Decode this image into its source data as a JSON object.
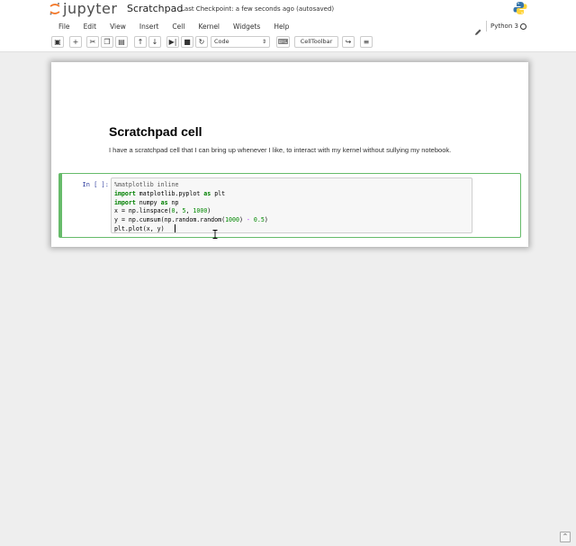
{
  "header": {
    "logo_text": "jupyter",
    "notebook_name": "Scratchpad",
    "checkpoint": "Last Checkpoint: a few seconds ago (autosaved)"
  },
  "menubar": {
    "items": [
      "File",
      "Edit",
      "View",
      "Insert",
      "Cell",
      "Kernel",
      "Widgets",
      "Help"
    ]
  },
  "kernel": {
    "name": "Python 3"
  },
  "toolbar": {
    "buttons": [
      {
        "name": "save-button",
        "glyph": "▣"
      },
      {
        "name": "insert-cell-below-button",
        "glyph": "+"
      },
      {
        "name": "cut-button",
        "glyph": "✂"
      },
      {
        "name": "copy-button",
        "glyph": "❐"
      },
      {
        "name": "paste-button",
        "glyph": "▤"
      },
      {
        "name": "move-up-button",
        "glyph": "↑"
      },
      {
        "name": "move-down-button",
        "glyph": "↓"
      },
      {
        "name": "run-button",
        "glyph": "▶|"
      },
      {
        "name": "interrupt-button",
        "glyph": "■"
      },
      {
        "name": "restart-button",
        "glyph": "↻"
      }
    ],
    "cell_type": "Code",
    "keyboard_glyph": "⌨",
    "celltoolbar_label": "CellToolbar",
    "share_glyph": "↪",
    "list_glyph": "≡"
  },
  "notebook": {
    "heading": "Scratchpad cell",
    "paragraph": "I have a scratchpad cell that I can bring up whenever I like, to interact with my kernel without sullying my notebook.",
    "prompt": "In [ ]:"
  },
  "colors": {
    "cell_border": "#66bb6a",
    "prompt": "#303f9f",
    "keyword": "#008000"
  }
}
